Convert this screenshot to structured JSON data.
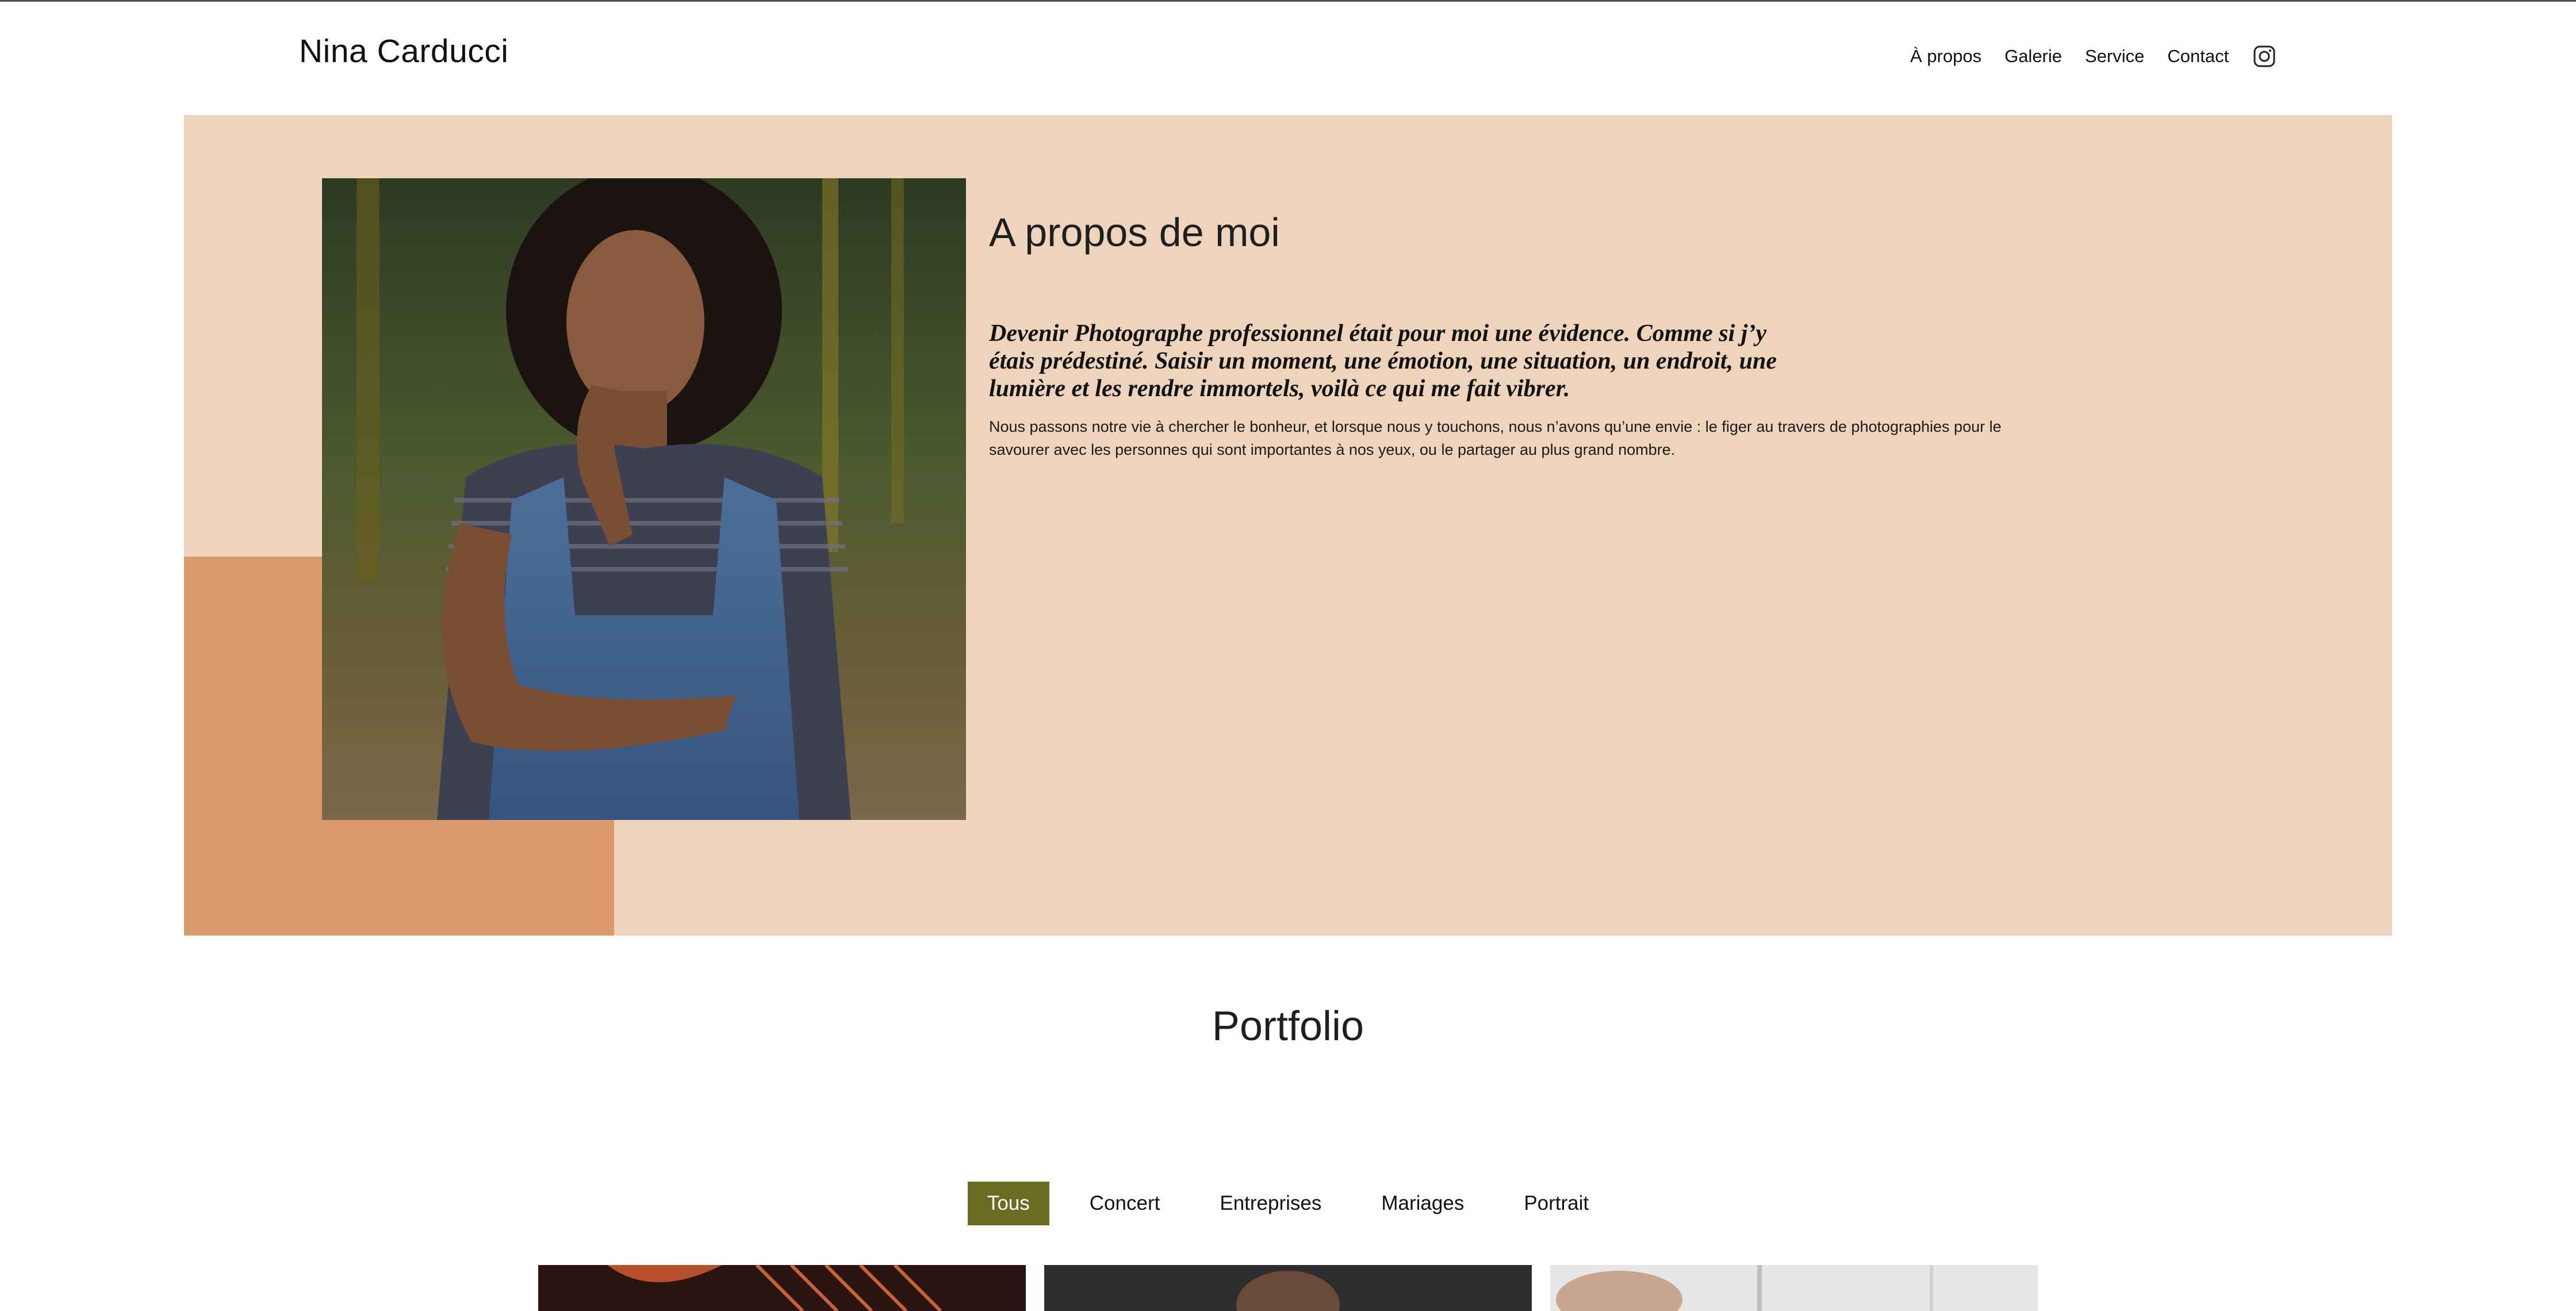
{
  "header": {
    "logo": "Nina Carducci",
    "nav": [
      {
        "label": "À propos"
      },
      {
        "label": "Galerie"
      },
      {
        "label": "Service"
      },
      {
        "label": "Contact"
      }
    ],
    "instagram_icon": "instagram-icon"
  },
  "about": {
    "title": "A propos de moi",
    "quote": "Devenir Photographe professionnel était pour moi une évidence. Comme si j’y étais prédestiné. Saisir un moment, une émotion, une situation, un endroit, une lumière et les rendre immortels, voilà ce qui me fait vibrer.",
    "text": "Nous passons notre vie à chercher le bonheur, et lorsque nous y touchons, nous n’avons qu’une envie : le figer au travers de photographies pour le savourer avec les personnes qui sont importantes à nos yeux, ou le partager au plus grand nombre."
  },
  "portfolio": {
    "title": "Portfolio",
    "filters": [
      {
        "label": "Tous",
        "active": true
      },
      {
        "label": "Concert",
        "active": false
      },
      {
        "label": "Entreprises",
        "active": false
      },
      {
        "label": "Mariages",
        "active": false
      },
      {
        "label": "Portrait",
        "active": false
      }
    ]
  },
  "colors": {
    "about_bg": "#eed4bc",
    "accent": "#da9a6c",
    "active_filter": "#6b6b21"
  }
}
